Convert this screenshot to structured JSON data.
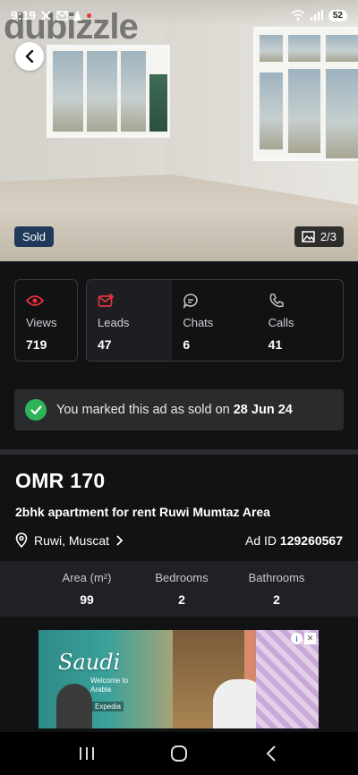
{
  "status_bar": {
    "time": "9:19",
    "battery": "52"
  },
  "watermark": "dubizzle",
  "hero": {
    "sold_tag": "Sold",
    "image_counter": "2/3"
  },
  "stats": {
    "views": {
      "label": "Views",
      "value": "719",
      "icon": "eye-icon"
    },
    "leads": {
      "label": "Leads",
      "value": "47",
      "icon": "envelope-icon"
    },
    "chats": {
      "label": "Chats",
      "value": "6",
      "icon": "chat-icon"
    },
    "calls": {
      "label": "Calls",
      "value": "41",
      "icon": "phone-icon"
    }
  },
  "sold_banner": {
    "text": "You marked this ad as sold on",
    "date": "28 Jun 24"
  },
  "listing": {
    "price": "OMR 170",
    "title": "2bhk apartment for rent Ruwi Mumtaz Area",
    "location": "Ruwi, Muscat",
    "ad_id_label": "Ad ID",
    "ad_id": "129260567"
  },
  "specs": [
    {
      "label": "Area (m²)",
      "value": "99"
    },
    {
      "label": "Bedrooms",
      "value": "2"
    },
    {
      "label": "Bathrooms",
      "value": "2"
    }
  ],
  "ad": {
    "title": "Saudi",
    "subtitle": "Welcome to Arabia",
    "partner": "Expedia"
  },
  "colors": {
    "accent_red": "#e8323c",
    "success_green": "#2fb35a",
    "sold_tag_bg": "#1f3a5a"
  }
}
